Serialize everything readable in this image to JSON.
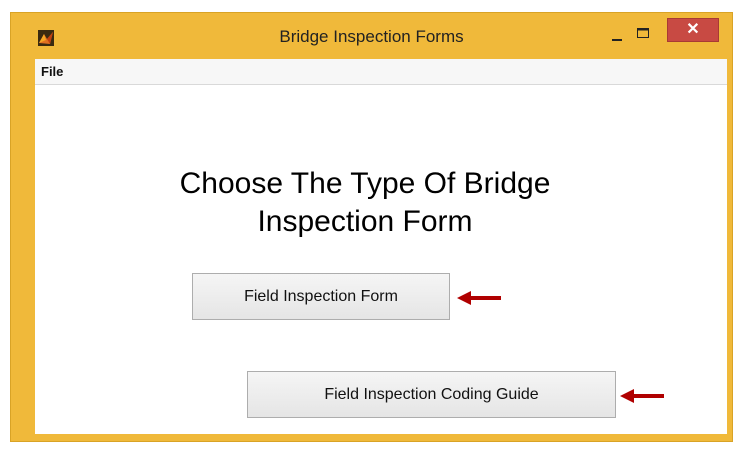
{
  "window": {
    "title": "Bridge Inspection Forms",
    "app_icon": "matlab-icon",
    "close_glyph": "✕",
    "frame_color": "#f0b93a",
    "close_color": "#c84a43"
  },
  "menu": {
    "items": [
      {
        "label": "File"
      }
    ]
  },
  "main": {
    "heading_line1": "Choose The Type Of Bridge",
    "heading_line2": "Inspection Form",
    "buttons": [
      {
        "label": "Field Inspection Form"
      },
      {
        "label": "Field Inspection Coding Guide"
      }
    ],
    "annotation_arrow_color": "#b00000"
  }
}
